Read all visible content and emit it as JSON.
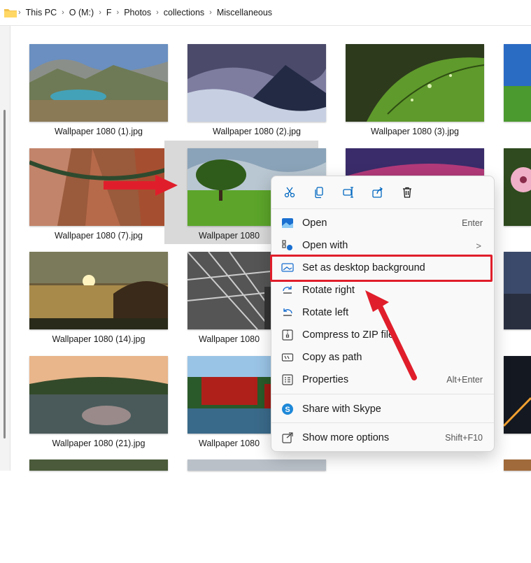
{
  "breadcrumb": [
    "This PC",
    "O (M:)",
    "F",
    "Photos",
    "collections",
    "Miscellaneous"
  ],
  "tiles": [
    {
      "caption": "Wallpaper 1080 (1).jpg"
    },
    {
      "caption": "Wallpaper 1080 (2).jpg"
    },
    {
      "caption": "Wallpaper 1080 (3).jpg"
    },
    {
      "caption": "Wallpaper 1080 (7).jpg"
    },
    {
      "caption": "Wallpaper 1080"
    },
    {
      "caption": ""
    },
    {
      "caption": "Wallpaper 1080 (14).jpg"
    },
    {
      "caption": "Wallpaper 1080"
    },
    {
      "caption": "Wallpaper 1080 (21).jpg"
    },
    {
      "caption": "Wallpaper 1080"
    }
  ],
  "context_menu": {
    "toolbar": [
      "cut-icon",
      "copy-icon",
      "rename-icon",
      "share-icon",
      "delete-icon"
    ],
    "items": [
      {
        "label": "Open",
        "shortcut": "Enter",
        "icon": "photos-app-icon"
      },
      {
        "label": "Open with",
        "shortcut": "",
        "icon": "open-with-icon",
        "submenu": ">"
      },
      {
        "label": "Set as desktop background",
        "shortcut": "",
        "icon": "desktop-background-icon"
      },
      {
        "label": "Rotate right",
        "shortcut": "",
        "icon": "rotate-right-icon"
      },
      {
        "label": "Rotate left",
        "shortcut": "",
        "icon": "rotate-left-icon"
      },
      {
        "label": "Compress to ZIP file",
        "shortcut": "",
        "icon": "zip-icon"
      },
      {
        "label": "Copy as path",
        "shortcut": "",
        "icon": "copy-path-icon"
      },
      {
        "label": "Properties",
        "shortcut": "Alt+Enter",
        "icon": "properties-icon"
      },
      {
        "label": "Share with Skype",
        "shortcut": "",
        "icon": "skype-icon"
      },
      {
        "label": "Show more options",
        "shortcut": "Shift+F10",
        "icon": "more-options-icon"
      }
    ]
  },
  "colors": {
    "accent": "#0067c0",
    "annotation": "#e01e2b",
    "selection": "#d9d9d9"
  }
}
